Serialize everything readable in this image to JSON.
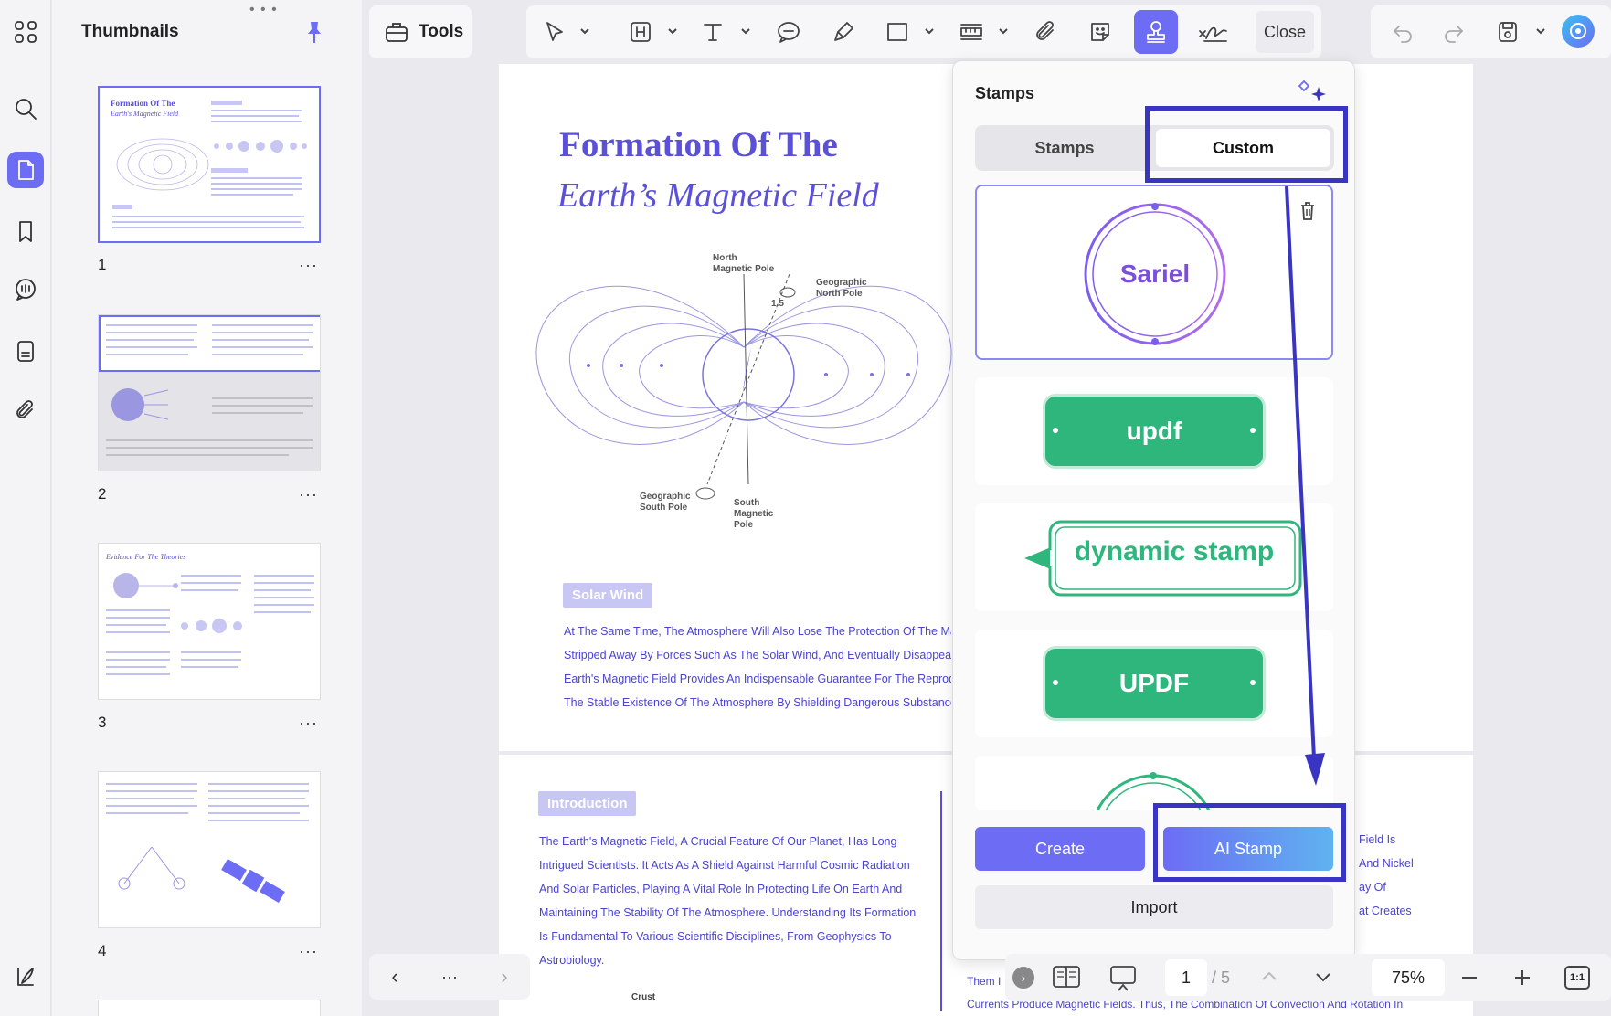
{
  "sidebar": {
    "title": "Thumbnails",
    "thumbnails": [
      {
        "number": "1",
        "heading": "Formation Of The",
        "subheading": "Earth's Magnetic Field"
      },
      {
        "number": "2"
      },
      {
        "number": "3",
        "heading": "Evidence For The Theories"
      },
      {
        "number": "4"
      }
    ],
    "more": "···"
  },
  "toolbar": {
    "tools_label": "Tools",
    "close_label": "Close"
  },
  "document": {
    "title_line1": "Formation Of The",
    "title_line2": "Earth’s Magnetic Field",
    "diagram_labels": {
      "north_mag": "North\nMagnetic Pole",
      "geo_north": "Geographic\nNorth Pole",
      "angle": "1.5",
      "geo_south": "Geographic\nSouth Pole",
      "south_mag": "South\nMagnetic\nPole",
      "crust": "Crust"
    },
    "solar_wind_tag": "Solar Wind",
    "solar_wind_lines": [
      "At The Same Time, The Atmosphere Will Also Lose The Protection Of The Mag",
      "Stripped Away By Forces Such As The Solar Wind, And Eventually Disappear. I",
      "Earth's Magnetic Field Provides An Indispensable Guarantee For The Reproduc",
      "The Stable Existence Of The Atmosphere By Shielding Dangerous Substances"
    ],
    "intro_tag": "Introduction",
    "intro_lines": [
      "The Earth's Magnetic Field, A Crucial Feature Of Our Planet, Has Long",
      "Intrigued Scientists. It Acts As A Shield Against Harmful Cosmic Radiation",
      "And Solar Particles, Playing A Vital Role In Protecting Life On Earth And",
      "Maintaining The Stability Of The Atmosphere. Understanding Its Formation",
      "Is Fundamental To Various Scientific Disciplines, From Geophysics To",
      "Astrobiology."
    ],
    "right_col_fragments": [
      "Field Is",
      "And Nickel",
      "ay Of",
      "at Creates"
    ],
    "bottom_fragment_1": "Them I",
    "bottom_fragment_2": "Currents Produce Magnetic Fields. Thus, The Combination Of Convection And Rotation In"
  },
  "stamps_panel": {
    "title": "Stamps",
    "tabs": [
      "Stamps",
      "Custom"
    ],
    "active_tab": "Custom",
    "custom_stamps": [
      "Sariel",
      "updf",
      "dynamic stamp",
      "UPDF"
    ],
    "create_label": "Create",
    "ai_stamp_label": "AI Stamp",
    "import_label": "Import"
  },
  "pager": {
    "current_page": "1",
    "total": "/ 5",
    "zoom": "75%",
    "more": "···"
  },
  "colors": {
    "accent": "#6c6cf5",
    "stamp_green": "#2fb67c",
    "stamp_purple": "#8b5cf6",
    "doc_blue": "#5b50d8"
  }
}
